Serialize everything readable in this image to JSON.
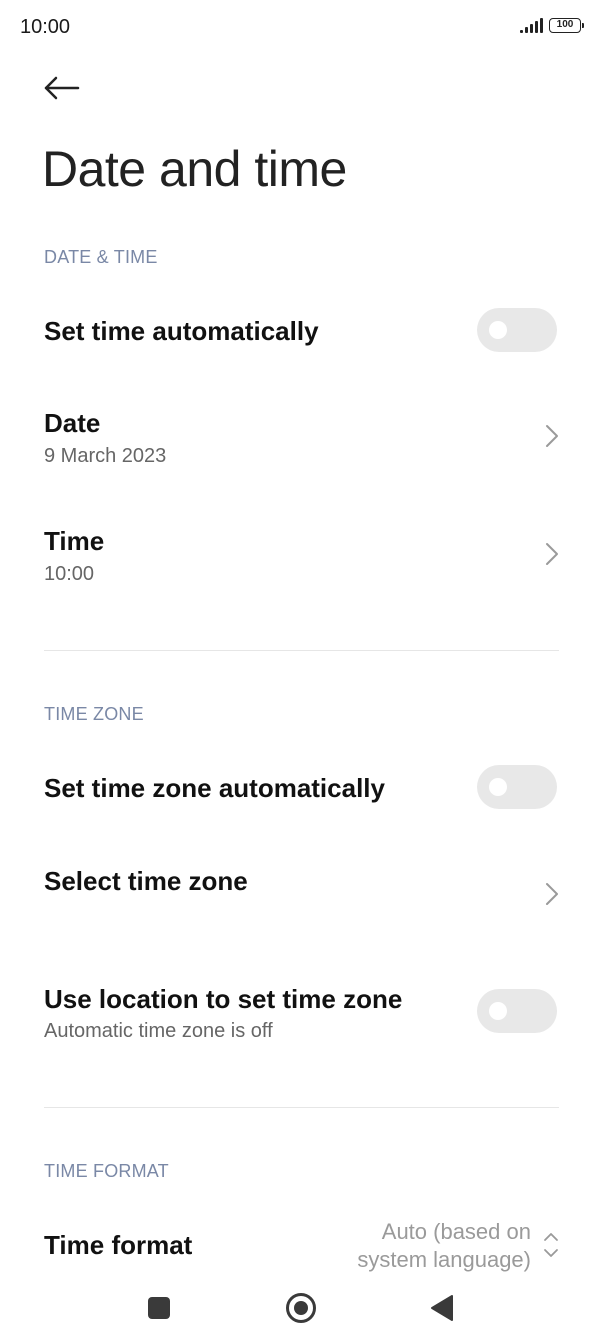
{
  "status_bar": {
    "time": "10:00",
    "battery_level": "100"
  },
  "header": {
    "title": "Date and time"
  },
  "sections": {
    "date_time": {
      "header": "DATE & TIME",
      "set_time_auto": {
        "label": "Set time automatically",
        "enabled": false
      },
      "date": {
        "label": "Date",
        "value": "9 March 2023"
      },
      "time": {
        "label": "Time",
        "value": "10:00"
      }
    },
    "time_zone": {
      "header": "TIME ZONE",
      "set_zone_auto": {
        "label": "Set time zone automatically",
        "enabled": false
      },
      "select_zone": {
        "label": "Select time zone"
      },
      "use_location": {
        "label": "Use location to set time zone",
        "summary": "Automatic time zone is off",
        "enabled": false
      }
    },
    "time_format": {
      "header": "TIME FORMAT",
      "format": {
        "label": "Time format",
        "value_line1": "Auto (based on",
        "value_line2": "system language)"
      }
    }
  },
  "colors": {
    "section_header": "#7a88a6",
    "toggle_off": "#e8e8e8"
  }
}
